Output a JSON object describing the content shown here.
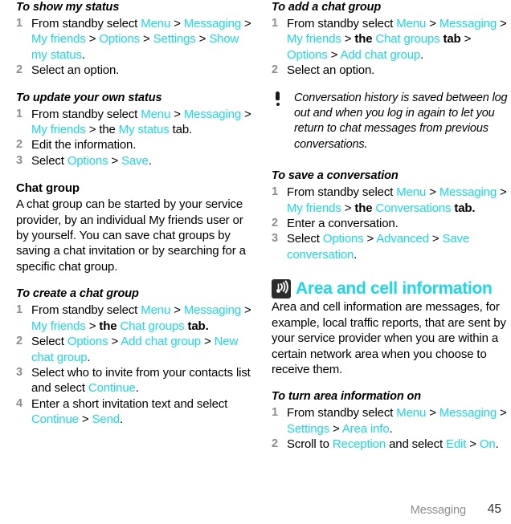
{
  "footer": {
    "section_label": "Messaging",
    "page_number": "45"
  },
  "colors": {
    "link": "#1ad7f0",
    "step_number": "#8d8d8d",
    "footer_label": "#8d8d8d",
    "icon_box": "#2b2b2b"
  },
  "left_column": {
    "proc_show_status": {
      "title": "To show my status",
      "steps": [
        {
          "num": "1",
          "parts": [
            {
              "t": "From standby select ",
              "s": "plain"
            },
            {
              "t": "Menu",
              "s": "link"
            },
            {
              "t": " > ",
              "s": "plain"
            },
            {
              "t": "Messaging",
              "s": "link"
            },
            {
              "t": " > ",
              "s": "plain"
            },
            {
              "t": "My friends",
              "s": "link"
            },
            {
              "t": " > ",
              "s": "plain"
            },
            {
              "t": "Options",
              "s": "link"
            },
            {
              "t": " > ",
              "s": "plain"
            },
            {
              "t": "Settings",
              "s": "link"
            },
            {
              "t": " > ",
              "s": "plain"
            },
            {
              "t": "Show my status",
              "s": "link"
            },
            {
              "t": ".",
              "s": "plain"
            }
          ]
        },
        {
          "num": "2",
          "parts": [
            {
              "t": "Select an option.",
              "s": "plain"
            }
          ]
        }
      ]
    },
    "proc_update_status": {
      "title": "To update your own status",
      "steps": [
        {
          "num": "1",
          "parts": [
            {
              "t": "From standby select ",
              "s": "plain"
            },
            {
              "t": "Menu",
              "s": "link"
            },
            {
              "t": " > ",
              "s": "plain"
            },
            {
              "t": "Messaging",
              "s": "link"
            },
            {
              "t": " > ",
              "s": "plain"
            },
            {
              "t": "My friends",
              "s": "link"
            },
            {
              "t": " > ",
              "s": "plain"
            },
            {
              "t": "the ",
              "s": "plain"
            },
            {
              "t": "My status",
              "s": "link"
            },
            {
              "t": " tab.",
              "s": "plain"
            }
          ]
        },
        {
          "num": "2",
          "parts": [
            {
              "t": "Edit the information.",
              "s": "plain"
            }
          ]
        },
        {
          "num": "3",
          "parts": [
            {
              "t": "Select ",
              "s": "plain"
            },
            {
              "t": "Options",
              "s": "link"
            },
            {
              "t": " > ",
              "s": "plain"
            },
            {
              "t": "Save",
              "s": "link"
            },
            {
              "t": ".",
              "s": "plain"
            }
          ]
        }
      ]
    },
    "chat_group_section": {
      "title": "Chat group",
      "body": "A chat group can be started by your service provider, by an individual My friends user or by yourself. You can save chat groups by saving a chat invitation or by searching for a specific chat group."
    },
    "proc_create_chat_group": {
      "title": "To create a chat group",
      "steps": [
        {
          "num": "1",
          "parts": [
            {
              "t": "From standby select ",
              "s": "plain"
            },
            {
              "t": "Menu",
              "s": "link"
            },
            {
              "t": " > ",
              "s": "plain"
            },
            {
              "t": "Messaging",
              "s": "link"
            },
            {
              "t": " > ",
              "s": "plain"
            },
            {
              "t": "My friends",
              "s": "link"
            },
            {
              "t": " > ",
              "s": "plain"
            },
            {
              "t": "the ",
              "s": "bold"
            },
            {
              "t": "Chat groups",
              "s": "link"
            },
            {
              "t": " tab.",
              "s": "bold"
            }
          ]
        },
        {
          "num": "2",
          "parts": [
            {
              "t": "Select ",
              "s": "plain"
            },
            {
              "t": "Options",
              "s": "link"
            },
            {
              "t": " > ",
              "s": "plain"
            },
            {
              "t": "Add chat group",
              "s": "link"
            },
            {
              "t": " > ",
              "s": "plain"
            },
            {
              "t": "New chat group",
              "s": "link"
            },
            {
              "t": ".",
              "s": "plain"
            }
          ]
        },
        {
          "num": "3",
          "parts": [
            {
              "t": "Select who to invite from your contacts list and select ",
              "s": "plain"
            },
            {
              "t": "Continue",
              "s": "link"
            },
            {
              "t": ".",
              "s": "plain"
            }
          ]
        },
        {
          "num": "4",
          "parts": [
            {
              "t": "Enter a short invitation text and select ",
              "s": "plain"
            },
            {
              "t": "Continue",
              "s": "link"
            },
            {
              "t": " > ",
              "s": "plain"
            },
            {
              "t": "Send",
              "s": "link"
            },
            {
              "t": ".",
              "s": "plain"
            }
          ]
        }
      ]
    }
  },
  "right_column": {
    "proc_add_chat_group": {
      "title": "To add a chat group",
      "steps": [
        {
          "num": "1",
          "parts": [
            {
              "t": "From standby select ",
              "s": "plain"
            },
            {
              "t": "Menu",
              "s": "link"
            },
            {
              "t": " > ",
              "s": "plain"
            },
            {
              "t": "Messaging",
              "s": "link"
            },
            {
              "t": " > ",
              "s": "plain"
            },
            {
              "t": "My friends",
              "s": "link"
            },
            {
              "t": " > ",
              "s": "plain"
            },
            {
              "t": "the ",
              "s": "bold"
            },
            {
              "t": "Chat groups",
              "s": "link"
            },
            {
              "t": " tab",
              "s": "bold"
            },
            {
              "t": " > ",
              "s": "plain"
            },
            {
              "t": "Options",
              "s": "link"
            },
            {
              "t": " > ",
              "s": "plain"
            },
            {
              "t": "Add chat group",
              "s": "link"
            },
            {
              "t": ".",
              "s": "plain"
            }
          ]
        },
        {
          "num": "2",
          "parts": [
            {
              "t": "Select an option.",
              "s": "plain"
            }
          ]
        }
      ]
    },
    "note": {
      "icon": "exclamation-note-icon",
      "text": "Conversation history is saved between log out and when you log in again to let you return to chat messages from previous conversations."
    },
    "proc_save_conversation": {
      "title": "To save a conversation",
      "steps": [
        {
          "num": "1",
          "parts": [
            {
              "t": "From standby select ",
              "s": "plain"
            },
            {
              "t": "Menu",
              "s": "link"
            },
            {
              "t": " > ",
              "s": "plain"
            },
            {
              "t": "Messaging",
              "s": "link"
            },
            {
              "t": " > ",
              "s": "plain"
            },
            {
              "t": "My friends",
              "s": "link"
            },
            {
              "t": " > ",
              "s": "plain"
            },
            {
              "t": "the ",
              "s": "bold"
            },
            {
              "t": "Conversations",
              "s": "link"
            },
            {
              "t": " tab.",
              "s": "bold"
            }
          ]
        },
        {
          "num": "2",
          "parts": [
            {
              "t": "Enter a conversation.",
              "s": "plain"
            }
          ]
        },
        {
          "num": "3",
          "parts": [
            {
              "t": "Select ",
              "s": "plain"
            },
            {
              "t": "Options",
              "s": "link"
            },
            {
              "t": " > ",
              "s": "plain"
            },
            {
              "t": "Advanced",
              "s": "link"
            },
            {
              "t": " > ",
              "s": "plain"
            },
            {
              "t": "Save conversation",
              "s": "link"
            },
            {
              "t": ".",
              "s": "plain"
            }
          ]
        }
      ]
    },
    "area_cell_section": {
      "icon": "broadcast-antenna-icon",
      "title": "Area and cell information",
      "body": "Area and cell information are messages, for example, local traffic reports, that are sent by your service provider when you are within a certain network area when you choose to receive them."
    },
    "proc_turn_area_info_on": {
      "title": "To turn area information on",
      "steps": [
        {
          "num": "1",
          "parts": [
            {
              "t": "From standby select ",
              "s": "plain"
            },
            {
              "t": "Menu",
              "s": "link"
            },
            {
              "t": " > ",
              "s": "plain"
            },
            {
              "t": "Messaging",
              "s": "link"
            },
            {
              "t": " > ",
              "s": "plain"
            },
            {
              "t": "Settings",
              "s": "link"
            },
            {
              "t": " > ",
              "s": "plain"
            },
            {
              "t": "Area info",
              "s": "link"
            },
            {
              "t": ".",
              "s": "plain"
            }
          ]
        },
        {
          "num": "2",
          "parts": [
            {
              "t": "Scroll to ",
              "s": "plain"
            },
            {
              "t": "Reception",
              "s": "link"
            },
            {
              "t": " and select ",
              "s": "plain"
            },
            {
              "t": "Edit",
              "s": "link"
            },
            {
              "t": " > ",
              "s": "plain"
            },
            {
              "t": "On",
              "s": "link"
            },
            {
              "t": ".",
              "s": "plain"
            }
          ]
        }
      ]
    }
  }
}
